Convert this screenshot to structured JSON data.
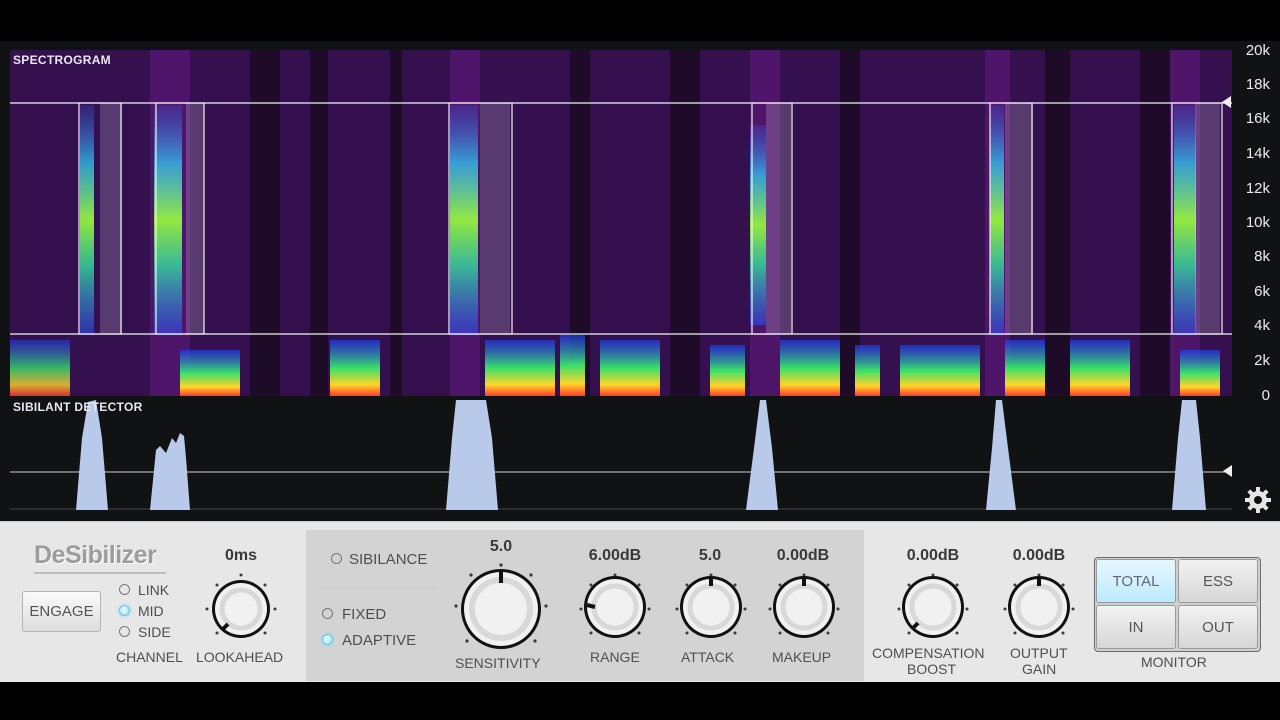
{
  "display": {
    "spectrogram_label": "SPECTROGRAM",
    "detector_label": "SIBILANT DETECTOR",
    "freq_axis": [
      "20k",
      "18k",
      "16k",
      "14k",
      "12k",
      "10k",
      "8k",
      "6k",
      "4k",
      "2k",
      "0"
    ],
    "settings_icon": "gear-icon"
  },
  "logo": "DeSibilizer",
  "engage": {
    "label": "ENGAGE"
  },
  "channel": {
    "label": "CHANNEL",
    "options": [
      {
        "label": "LINK",
        "active": false
      },
      {
        "label": "MID",
        "active": true
      },
      {
        "label": "SIDE",
        "active": false
      }
    ]
  },
  "lookahead": {
    "value": "0ms",
    "label": "LOOKAHEAD"
  },
  "mode": {
    "sibilance": {
      "label": "SIBILANCE",
      "active": false
    },
    "fixed": {
      "label": "FIXED",
      "active": false
    },
    "adaptive": {
      "label": "ADAPTIVE",
      "active": true
    }
  },
  "sensitivity": {
    "value": "5.0",
    "label": "SENSITIVITY"
  },
  "range": {
    "value": "6.00dB",
    "label": "RANGE"
  },
  "attack": {
    "value": "5.0",
    "label": "ATTACK"
  },
  "makeup": {
    "value": "0.00dB",
    "label": "MAKEUP"
  },
  "compensation": {
    "value": "0.00dB",
    "label_1": "COMPENSATION",
    "label_2": "BOOST"
  },
  "output": {
    "value": "0.00dB",
    "label_1": "OUTPUT",
    "label_2": "GAIN"
  },
  "monitor": {
    "label": "MONITOR",
    "buttons": [
      {
        "label": "TOTAL",
        "active": true
      },
      {
        "label": "ESS",
        "active": false
      },
      {
        "label": "IN",
        "active": false
      },
      {
        "label": "OUT",
        "active": false
      }
    ]
  },
  "colors": {
    "accent": "#8ee0ff",
    "detector_fill": "#b9c9ea",
    "spectrogram_bg": "#3a0f58"
  }
}
